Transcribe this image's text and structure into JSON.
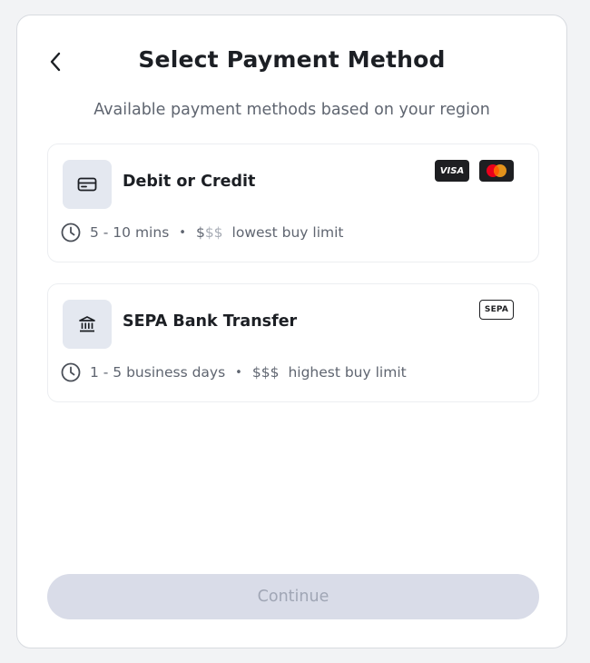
{
  "header": {
    "title": "Select Payment Method",
    "subtitle": "Available payment methods based on your region"
  },
  "methods": [
    {
      "name": "Debit or Credit",
      "icon": "credit-card-icon",
      "time": "5 - 10 mins",
      "price_active": "$",
      "price_inactive": "$$",
      "limit": "lowest buy limit",
      "logos": [
        "VISA",
        "mastercard-logo"
      ]
    },
    {
      "name": "SEPA Bank Transfer",
      "icon": "bank-icon",
      "time": "1 - 5 business days",
      "price_active": "$$$",
      "price_inactive": "",
      "limit": "highest buy limit",
      "logos": [
        "SEPA"
      ]
    }
  ],
  "footer": {
    "continue_label": "Continue",
    "continue_enabled": false
  },
  "colors": {
    "background": "#f2f3f5",
    "icon_tile": "#e4e8f0",
    "button_disabled": "#d9dce8",
    "mastercard_red": "#eb001b",
    "mastercard_orange": "#f79e1b",
    "sepa_star": "#ffcc00"
  }
}
